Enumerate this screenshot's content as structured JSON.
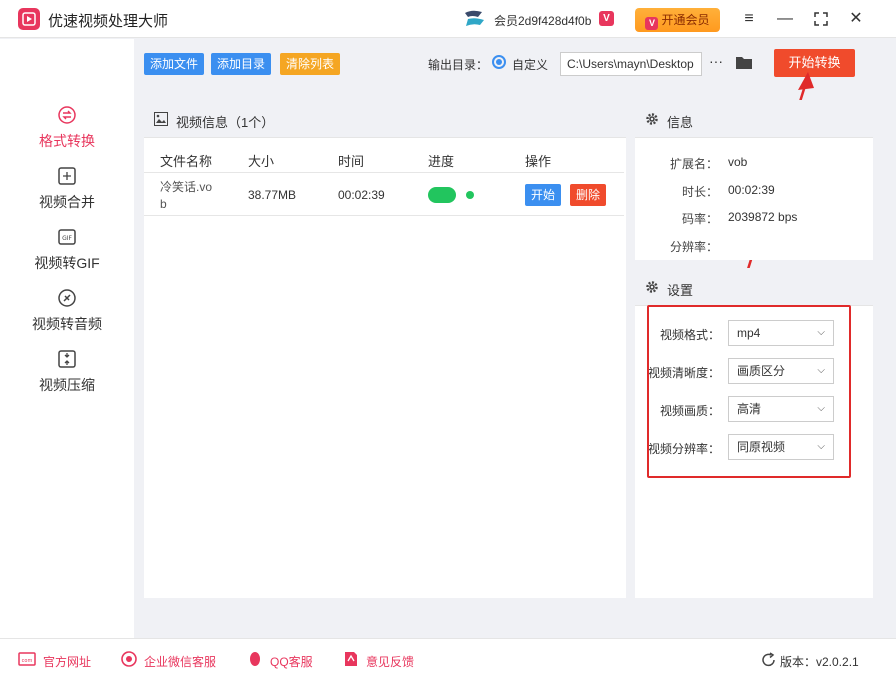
{
  "app": {
    "title": "优速视频处理大师"
  },
  "titlebar": {
    "member_id": "会员2d9f428d4f0b",
    "member_badge": "V",
    "vip_button": "开通会员",
    "vip_icon": "V",
    "menu_icon": "≡",
    "minimize_icon": "—",
    "maximize_icon": "⛶",
    "close_icon": "✕"
  },
  "sidebar": {
    "items": [
      {
        "label": "格式转换",
        "icon": "format-convert-icon",
        "active": true
      },
      {
        "label": "视频合并",
        "icon": "merge-icon"
      },
      {
        "label": "视频转GIF",
        "icon": "gif-icon"
      },
      {
        "label": "视频转音频",
        "icon": "audio-icon"
      },
      {
        "label": "视频压缩",
        "icon": "compress-icon"
      }
    ]
  },
  "toolbar": {
    "add_file": "添加文件",
    "add_folder": "添加目录",
    "clear_list": "清除列表",
    "output_label": "输出目录：",
    "custom_label": "自定义",
    "output_path": "C:\\Users\\mayn\\Desktop",
    "more": "···",
    "start": "开始转换"
  },
  "video_panel": {
    "title": "视频信息（1个）",
    "columns": [
      "文件名称",
      "大小",
      "时间",
      "进度",
      "操作"
    ],
    "rows": [
      {
        "name_line1": "冷笑话.vo",
        "name_line2": "b",
        "size": "38.77MB",
        "time": "00:02:39",
        "start": "开始",
        "delete": "删除"
      }
    ]
  },
  "info_panel": {
    "title": "信息",
    "ext_label": "扩展名：",
    "ext_value": "vob",
    "duration_label": "时长：",
    "duration_value": "00:02:39",
    "bitrate_label": "码率：",
    "bitrate_value": "2039872 bps",
    "resolution_label": "分辨率：",
    "resolution_value": ""
  },
  "settings_panel": {
    "title": "设置",
    "format_label": "视频格式：",
    "format_value": "mp4",
    "clarity_label": "视频清晰度：",
    "clarity_value": "画质区分",
    "quality_label": "视频画质：",
    "quality_value": "高清",
    "resolution_label": "视频分辨率：",
    "resolution_value": "同原视频"
  },
  "footer": {
    "website": "官方网址",
    "wechat": "企业微信客服",
    "qq": "QQ客服",
    "feedback": "意见反馈",
    "version": "版本：v2.0.2.1"
  },
  "colors": {
    "brand": "#e8365d",
    "start": "#f04b2c",
    "blue": "#3b8ff0",
    "orange": "#f5a623",
    "progress": "#22c55e",
    "highlight": "#e02a2a"
  }
}
